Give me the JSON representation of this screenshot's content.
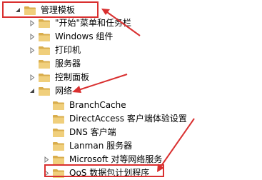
{
  "tree": {
    "items": [
      {
        "label": "管理模板",
        "expander": "expanded",
        "depth": 0
      },
      {
        "label": "\"开始\"菜单和任务栏",
        "expander": "collapsed",
        "depth": 1
      },
      {
        "label": "Windows 组件",
        "expander": "collapsed",
        "depth": 1
      },
      {
        "label": "打印机",
        "expander": "collapsed",
        "depth": 1
      },
      {
        "label": "服务器",
        "expander": "none",
        "depth": 1
      },
      {
        "label": "控制面板",
        "expander": "collapsed",
        "depth": 1
      },
      {
        "label": "网络",
        "expander": "expanded",
        "depth": 1
      },
      {
        "label": "BranchCache",
        "expander": "none",
        "depth": 2
      },
      {
        "label": "DirectAccess 客户端体验设置",
        "expander": "none",
        "depth": 2
      },
      {
        "label": "DNS 客户端",
        "expander": "none",
        "depth": 2
      },
      {
        "label": "Lanman 服务器",
        "expander": "none",
        "depth": 2
      },
      {
        "label": "Microsoft 对等网络服务",
        "expander": "collapsed",
        "depth": 2
      },
      {
        "label": "QoS 数据包计划程序",
        "expander": "collapsed",
        "depth": 2
      }
    ]
  },
  "colors": {
    "folder_body": "#e8c26a",
    "folder_tab": "#d9ad4c",
    "annotation_red": "#d93030",
    "selection": "#cce8ff"
  },
  "icons": {
    "expanded": "triangle-down-icon",
    "collapsed": "triangle-right-icon",
    "folder": "folder-icon"
  }
}
